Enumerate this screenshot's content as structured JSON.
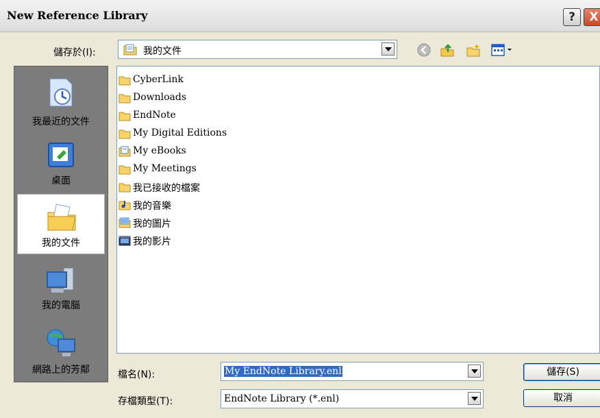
{
  "window": {
    "title": "New Reference Library",
    "help_label": "?",
    "close_label": "X"
  },
  "lookin": {
    "label": "儲存於(I):",
    "value": "我的文件"
  },
  "places": [
    {
      "label": "我最近的文件",
      "icon": "recent-documents-icon"
    },
    {
      "label": "桌面",
      "icon": "desktop-icon"
    },
    {
      "label": "我的文件",
      "icon": "my-documents-icon",
      "selected": true
    },
    {
      "label": "我的電腦",
      "icon": "my-computer-icon"
    },
    {
      "label": "網路上的芳鄰",
      "icon": "network-places-icon"
    }
  ],
  "files": [
    {
      "name": "CyberLink",
      "icon": "folder-icon"
    },
    {
      "name": "Downloads",
      "icon": "folder-icon"
    },
    {
      "name": "EndNote",
      "icon": "folder-icon"
    },
    {
      "name": "My Digital Editions",
      "icon": "folder-icon"
    },
    {
      "name": "My eBooks",
      "icon": "ebook-folder-icon"
    },
    {
      "name": "My Meetings",
      "icon": "folder-icon"
    },
    {
      "name": "我已接收的檔案",
      "icon": "folder-icon"
    },
    {
      "name": "我的音樂",
      "icon": "music-folder-icon"
    },
    {
      "name": "我的圖片",
      "icon": "pictures-folder-icon"
    },
    {
      "name": "我的影片",
      "icon": "videos-folder-icon"
    }
  ],
  "filename": {
    "label": "檔名(N):",
    "value": "My EndNote Library.enl"
  },
  "filetype": {
    "label": "存檔類型(T):",
    "value": "EndNote Library (*.enl)"
  },
  "buttons": {
    "save": "儲存(S)",
    "cancel": "取消"
  }
}
